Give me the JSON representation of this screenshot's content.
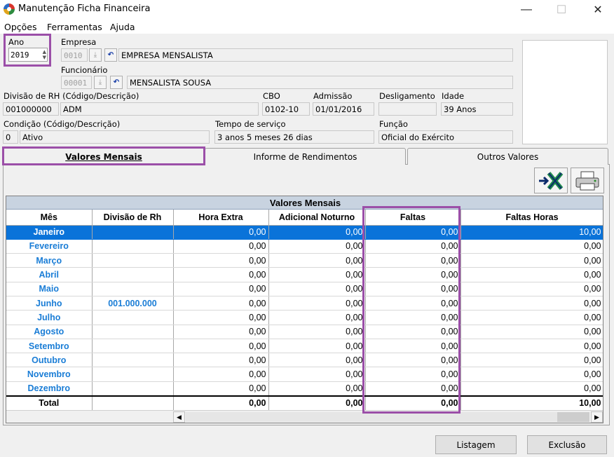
{
  "window": {
    "title": "Manutenção Ficha Financeira",
    "minimize": "—",
    "maximize": "☐",
    "close": "✕"
  },
  "menu": {
    "items": [
      "Opções",
      "Ferramentas",
      "Ajuda"
    ]
  },
  "form": {
    "ano_label": "Ano",
    "ano_value": "2019",
    "empresa_label": "Empresa",
    "empresa_code": "0010",
    "empresa_name": "EMPRESA MENSALISTA",
    "funcionario_label": "Funcionário",
    "funcionario_code": "00001",
    "funcionario_name": "MENSALISTA SOUSA",
    "divisao_label": "Divisão de RH (Código/Descrição)",
    "divisao_code": "001000000",
    "divisao_desc": "ADM",
    "cbo_label": "CBO",
    "cbo_value": "0102-10",
    "admissao_label": "Admissão",
    "admissao_value": "01/01/2016",
    "desligamento_label": "Desligamento",
    "desligamento_value": "",
    "idade_label": "Idade",
    "idade_value": "39 Anos",
    "condicao_label": "Condição (Código/Descrição)",
    "condicao_code": "0",
    "condicao_desc": "Ativo",
    "tempo_label": "Tempo de serviço",
    "tempo_value": "3 anos 5 meses 26 dias",
    "funcao_label": "Função",
    "funcao_value": "Oficial do Exército"
  },
  "tabs": [
    {
      "label": "Valores Mensais",
      "active": true
    },
    {
      "label": "Informe de Rendimentos",
      "active": false
    },
    {
      "label": "Outros Valores",
      "active": false
    }
  ],
  "grid": {
    "caption": "Valores Mensais",
    "columns": [
      "Mês",
      "Divisão de Rh",
      "Hora Extra",
      "Adicional Noturno",
      "Faltas",
      "Faltas Horas"
    ],
    "rows": [
      [
        "Janeiro",
        "",
        "0,00",
        "0,00",
        "0,00",
        "10,00"
      ],
      [
        "Fevereiro",
        "",
        "0,00",
        "0,00",
        "0,00",
        "0,00"
      ],
      [
        "Março",
        "",
        "0,00",
        "0,00",
        "0,00",
        "0,00"
      ],
      [
        "Abril",
        "",
        "0,00",
        "0,00",
        "0,00",
        "0,00"
      ],
      [
        "Maio",
        "",
        "0,00",
        "0,00",
        "0,00",
        "0,00"
      ],
      [
        "Junho",
        "001.000.000",
        "0,00",
        "0,00",
        "0,00",
        "0,00"
      ],
      [
        "Julho",
        "",
        "0,00",
        "0,00",
        "0,00",
        "0,00"
      ],
      [
        "Agosto",
        "",
        "0,00",
        "0,00",
        "0,00",
        "0,00"
      ],
      [
        "Setembro",
        "",
        "0,00",
        "0,00",
        "0,00",
        "0,00"
      ],
      [
        "Outubro",
        "",
        "0,00",
        "0,00",
        "0,00",
        "0,00"
      ],
      [
        "Novembro",
        "",
        "0,00",
        "0,00",
        "0,00",
        "0,00"
      ],
      [
        "Dezembro",
        "",
        "0,00",
        "0,00",
        "0,00",
        "0,00"
      ]
    ],
    "total": [
      "Total",
      "",
      "0,00",
      "0,00",
      "0,00",
      "10,00"
    ],
    "selected_row": 0
  },
  "buttons": {
    "listagem": "Listagem",
    "exclusao": "Exclusão"
  },
  "colors": {
    "highlight": "#9b4fa8",
    "selection": "#0a73d9",
    "month_text": "#1a7dd6"
  }
}
